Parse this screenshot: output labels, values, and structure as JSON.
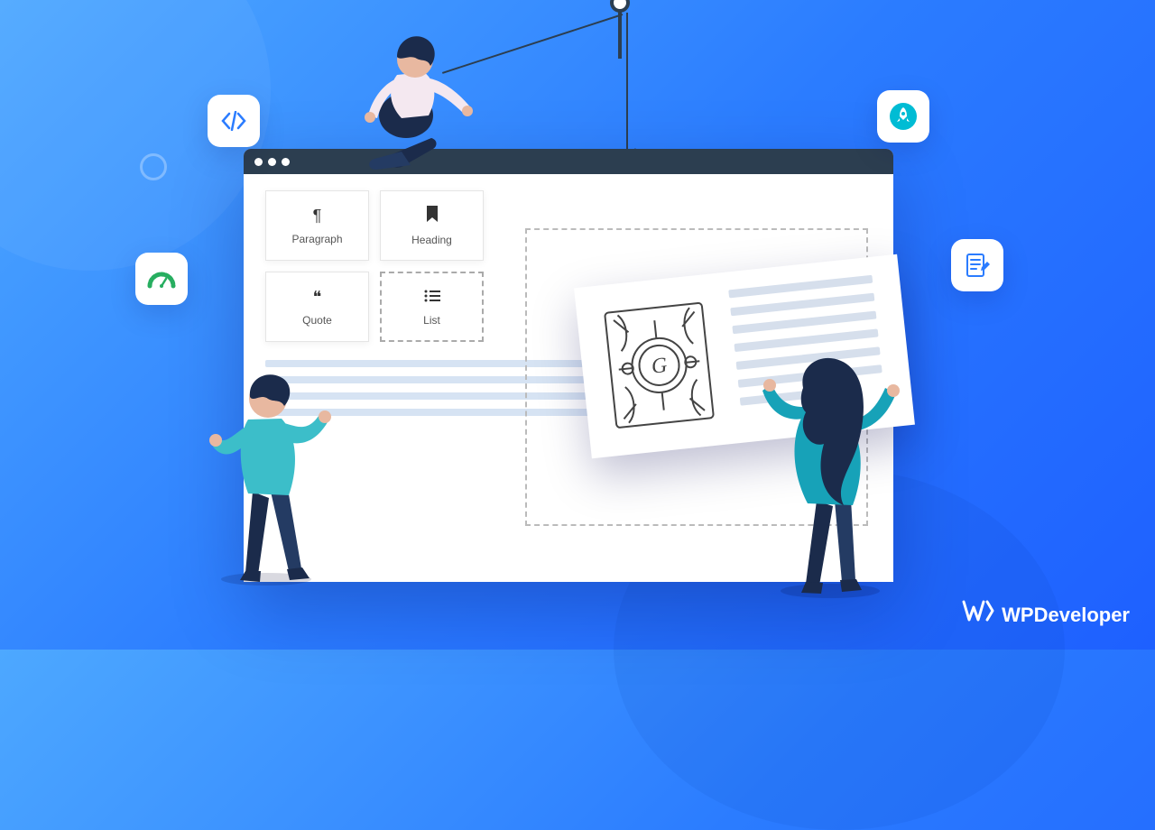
{
  "blocks": {
    "paragraph": {
      "label": "Paragraph",
      "icon": "¶"
    },
    "heading": {
      "label": "Heading",
      "icon": "▮"
    },
    "quote": {
      "label": "Quote",
      "icon": "❝"
    },
    "list": {
      "label": "List",
      "icon": "≡"
    }
  },
  "float_icons": {
    "code": "code-icon",
    "rocket": "rocket-icon",
    "gauge": "gauge-icon",
    "note": "note-icon"
  },
  "card": {
    "ornament_letter": "G"
  },
  "watermark": {
    "brand": "WPDeveloper"
  },
  "colors": {
    "accent_blue": "#2B7CFF",
    "dark": "#2C3E50",
    "green": "#27AE60",
    "cyan": "#00BCD4"
  }
}
